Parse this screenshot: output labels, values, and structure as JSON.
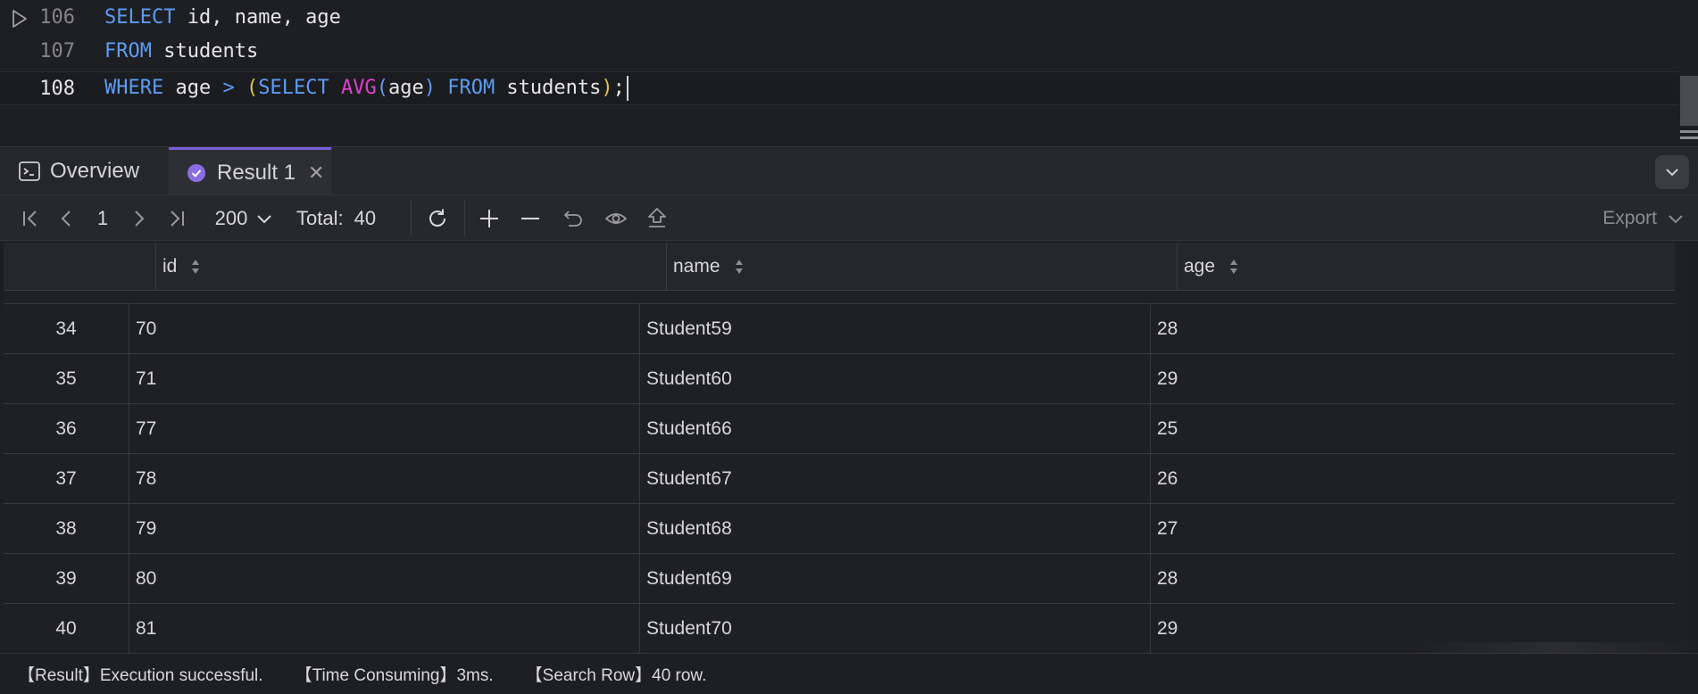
{
  "editor": {
    "lines": [
      {
        "number": "106",
        "tokens": [
          {
            "t": "SELECT",
            "c": "kw"
          },
          {
            "t": " id, name, age",
            "c": ""
          }
        ]
      },
      {
        "number": "107",
        "tokens": [
          {
            "t": "FROM",
            "c": "kw"
          },
          {
            "t": " students",
            "c": ""
          }
        ]
      },
      {
        "number": "108",
        "tokens": [
          {
            "t": "WHERE",
            "c": "kw"
          },
          {
            "t": " age ",
            "c": ""
          },
          {
            "t": ">",
            "c": "kw"
          },
          {
            "t": " ",
            "c": ""
          },
          {
            "t": "(",
            "c": "pn"
          },
          {
            "t": "SELECT",
            "c": "kw"
          },
          {
            "t": " ",
            "c": ""
          },
          {
            "t": "AVG",
            "c": "fn"
          },
          {
            "t": "(",
            "c": "kw"
          },
          {
            "t": "age",
            "c": ""
          },
          {
            "t": ")",
            "c": "kw"
          },
          {
            "t": " ",
            "c": ""
          },
          {
            "t": "FROM",
            "c": "kw"
          },
          {
            "t": " students",
            "c": ""
          },
          {
            "t": ")",
            "c": "pn"
          },
          {
            "t": ";",
            "c": ""
          }
        ]
      }
    ]
  },
  "tabs": {
    "overview": "Overview",
    "result": "Result 1"
  },
  "toolbar": {
    "page": "1",
    "page_size": "200",
    "total_label": "Total:",
    "total_value": "40",
    "export": "Export"
  },
  "table": {
    "columns": [
      "id",
      "name",
      "age"
    ],
    "rows": [
      {
        "n": "34",
        "id": "70",
        "name": "Student59",
        "age": "28"
      },
      {
        "n": "35",
        "id": "71",
        "name": "Student60",
        "age": "29"
      },
      {
        "n": "36",
        "id": "77",
        "name": "Student66",
        "age": "25"
      },
      {
        "n": "37",
        "id": "78",
        "name": "Student67",
        "age": "26"
      },
      {
        "n": "38",
        "id": "79",
        "name": "Student68",
        "age": "27"
      },
      {
        "n": "39",
        "id": "80",
        "name": "Student69",
        "age": "28"
      },
      {
        "n": "40",
        "id": "81",
        "name": "Student70",
        "age": "29"
      }
    ]
  },
  "status": {
    "result": "【Result】Execution successful.",
    "time": "【Time Consuming】3ms.",
    "rows": "【Search Row】40 row."
  },
  "colors": {
    "keyword": "#5c9cf5",
    "function": "#e040d0",
    "paren": "#e6c24c",
    "accent": "#7c5cdb"
  },
  "icons": [
    "run-icon",
    "terminal-icon",
    "success-check-icon",
    "close-icon",
    "chevron-down-icon",
    "first-page-icon",
    "prev-page-icon",
    "next-page-icon",
    "last-page-icon",
    "refresh-icon",
    "add-row-icon",
    "delete-row-icon",
    "undo-icon",
    "eye-icon",
    "upload-icon",
    "sort-icon"
  ]
}
